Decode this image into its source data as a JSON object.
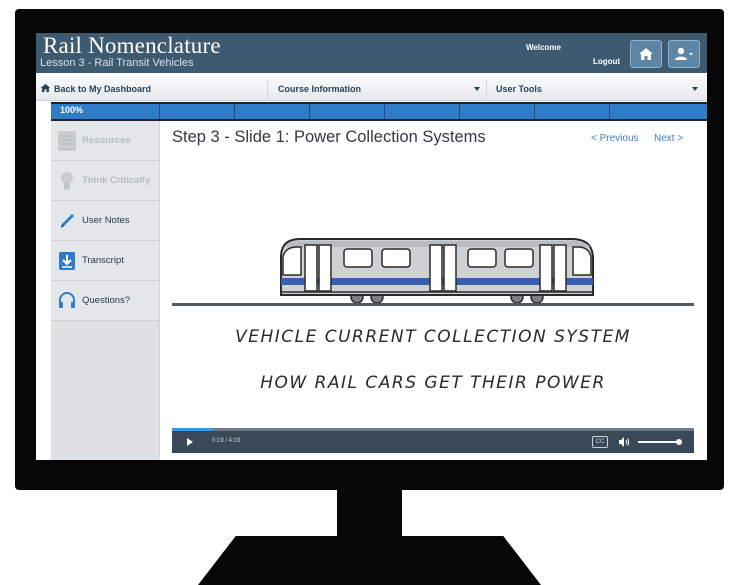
{
  "app": {
    "title": "Rail Nomenclature",
    "subtitle": "Lesson 3 - Rail Transit Vehicles",
    "welcome": "Welcome",
    "logout": "Logout"
  },
  "icons": {
    "home": "home-icon",
    "user": "user-icon"
  },
  "nav": {
    "back": "Back to My Dashboard",
    "course_info": "Course Information",
    "user_tools": "User Tools"
  },
  "progress": {
    "label": "100%",
    "value": 1.0
  },
  "sidebar": {
    "items": [
      {
        "label": "Resources",
        "icon": "resources-icon",
        "state": "disabled"
      },
      {
        "label": "Think Critically",
        "icon": "lightbulb-icon",
        "state": "disabled"
      },
      {
        "label": "User Notes",
        "icon": "pencil-icon",
        "state": "enabled"
      },
      {
        "label": "Transcript",
        "icon": "download-icon",
        "state": "enabled"
      },
      {
        "label": "Questions?",
        "icon": "headset-icon",
        "state": "enabled"
      }
    ]
  },
  "slide": {
    "title": "Step 3 - Slide 1: Power Collection Systems",
    "prev": "< Previous",
    "next": "Next >"
  },
  "video": {
    "caption_line1": "VEHICLE CURRENT COLLECTION SYSTEM",
    "caption_line2": "HOW RAIL CARS GET THEIR POWER",
    "time": "0:19  /  4:03",
    "progress": 0.08,
    "cc": "CC"
  },
  "colors": {
    "header": "#3d5a70",
    "progress_fill": "#2f7dc8",
    "link": "#3b80c7",
    "train_stripe": "#3b5fb0"
  }
}
